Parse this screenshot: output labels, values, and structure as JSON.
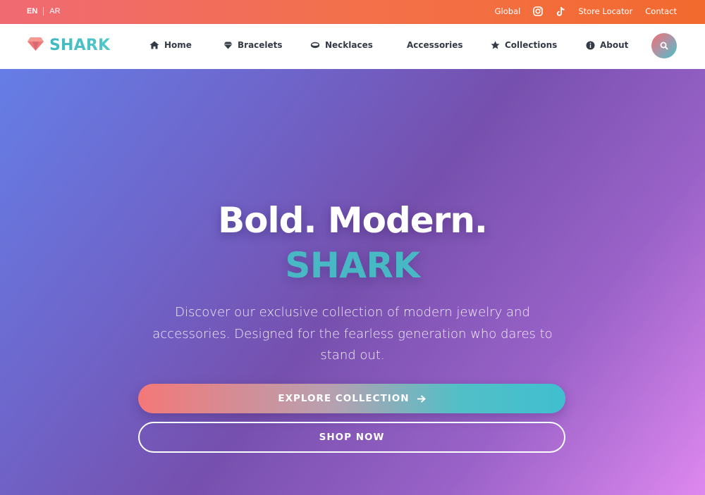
{
  "topbar": {
    "lang_active": "EN",
    "lang_other": "AR",
    "links": {
      "global": "Global",
      "store_locator": "Store Locator",
      "contact": "Contact"
    },
    "icons": [
      "instagram-icon",
      "tiktok-icon"
    ]
  },
  "nav": {
    "brand": "SHARK",
    "items": [
      {
        "label": "Home",
        "icon": "home-icon"
      },
      {
        "label": "Bracelets",
        "icon": "diamond-icon"
      },
      {
        "label": "Necklaces",
        "icon": "ring-icon"
      },
      {
        "label": "Accessories",
        "icon": ""
      },
      {
        "label": "Collections",
        "icon": "star-icon"
      },
      {
        "label": "About",
        "icon": "info-icon"
      }
    ],
    "search_icon": "search-icon"
  },
  "hero": {
    "title": "Bold. Modern.",
    "brand": "SHARK",
    "description": "Discover our exclusive collection of modern jewelry and accessories. Designed for the fearless generation who dares to stand out.",
    "primary_button": "EXPLORE COLLECTION",
    "secondary_button": "SHOP NOW"
  },
  "colors": {
    "topbar": "#f36a3e",
    "brand_teal": "#48b8c4",
    "hero_start": "#657ee6",
    "hero_end": "#de88ef"
  }
}
